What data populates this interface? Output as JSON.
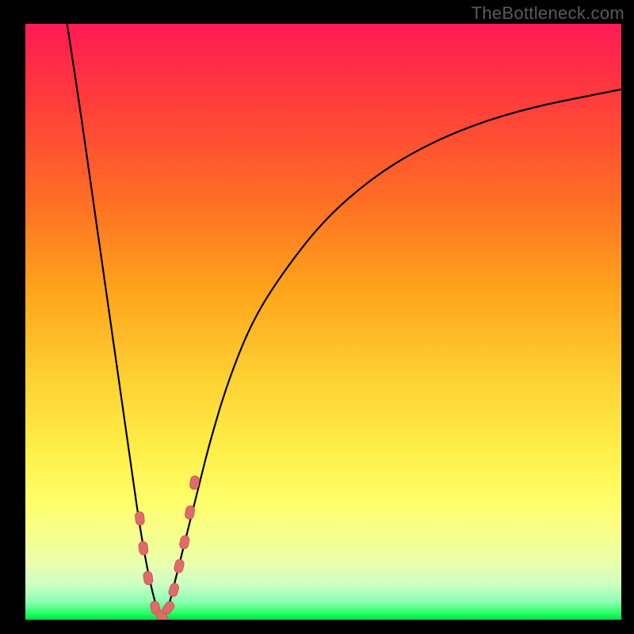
{
  "watermark": "TheBottleneck.com",
  "colors": {
    "background": "#000000",
    "curve_stroke": "#000000",
    "marker_fill": "#e06b6b",
    "marker_stroke": "#c94f4f",
    "gradient_top": "#ff1a54",
    "gradient_bottom": "#00e040"
  },
  "chart_data": {
    "type": "line",
    "title": "",
    "xlabel": "",
    "ylabel": "",
    "xlim": [
      0,
      100
    ],
    "ylim": [
      0,
      100
    ],
    "grid": false,
    "series": [
      {
        "name": "bottleneck-curve",
        "x": [
          7,
          9,
          11,
          13,
          15,
          16,
          17,
          18,
          19,
          20,
          21,
          22,
          23,
          24,
          25,
          27,
          29,
          31,
          34,
          38,
          43,
          50,
          58,
          66,
          75,
          85,
          95,
          100
        ],
        "y": [
          100,
          87,
          73,
          59,
          45,
          38,
          31,
          24,
          17,
          11,
          6,
          2,
          0,
          2,
          6,
          14,
          22,
          30,
          40,
          50,
          58,
          67,
          74,
          79,
          83,
          86,
          88,
          89
        ]
      }
    ],
    "markers": {
      "name": "highlight-pills",
      "x": [
        19.2,
        19.8,
        20.6,
        21.8,
        22.9,
        24.0,
        24.9,
        25.8,
        26.7,
        27.6,
        28.4
      ],
      "y": [
        17,
        12,
        7,
        2,
        0.5,
        2,
        5,
        9,
        13,
        18,
        23
      ]
    }
  }
}
